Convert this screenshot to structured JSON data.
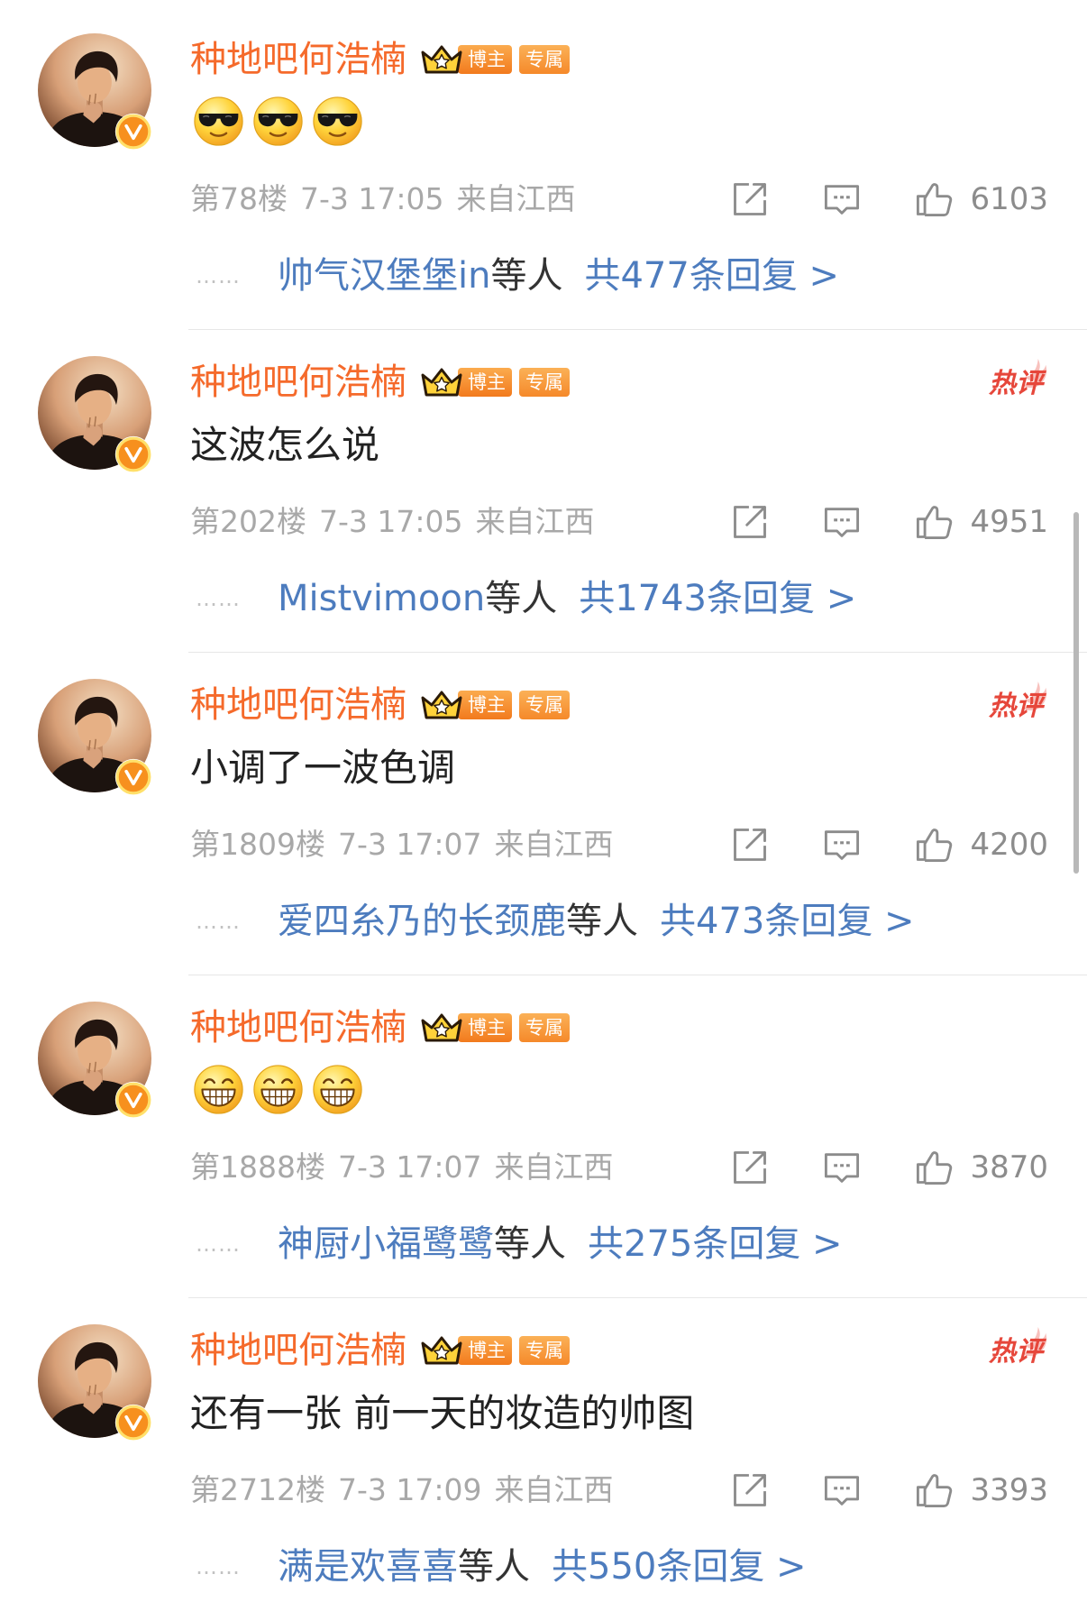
{
  "theme": {
    "name_color": "#f56a2b",
    "link_color": "#4d7cbe",
    "hot_color": "#e6473b",
    "meta_color": "#a8a8a8",
    "icon_color": "#8c8c8c"
  },
  "icons": {
    "avatar": "avatar-photo",
    "verified": "verified-v-icon",
    "crown": "crown-icon",
    "flame": "flame-icon",
    "share": "share-icon",
    "comment": "comment-icon",
    "like": "like-icon"
  },
  "comments": [
    {
      "user": {
        "name": "种地吧何浩楠",
        "badges": [
          "博主",
          "专属"
        ]
      },
      "content": {
        "emojis": [
          "cool-emoji",
          "cool-emoji",
          "cool-emoji"
        ]
      },
      "meta": {
        "floor": "第78楼",
        "time": "7-3 17:05",
        "location": "来自江西"
      },
      "actions": {
        "likes": "6103"
      },
      "replies": {
        "ellipsis": "……",
        "names": "帅气汉堡堡in",
        "suffix": "等人",
        "total": "共477条回复 >"
      }
    },
    {
      "user": {
        "name": "种地吧何浩楠",
        "badges": [
          "博主",
          "专属"
        ]
      },
      "hot_label": "热评",
      "content": {
        "text": "这波怎么说"
      },
      "meta": {
        "floor": "第202楼",
        "time": "7-3 17:05",
        "location": "来自江西"
      },
      "actions": {
        "likes": "4951"
      },
      "replies": {
        "ellipsis": "……",
        "names": "Mistvimoon",
        "suffix": "等人",
        "total": "共1743条回复 >"
      }
    },
    {
      "user": {
        "name": "种地吧何浩楠",
        "badges": [
          "博主",
          "专属"
        ]
      },
      "hot_label": "热评",
      "content": {
        "text": "小调了一波色调"
      },
      "meta": {
        "floor": "第1809楼",
        "time": "7-3 17:07",
        "location": "来自江西"
      },
      "actions": {
        "likes": "4200"
      },
      "replies": {
        "ellipsis": "……",
        "names": "爱四糸乃的长颈鹿",
        "suffix": "等人",
        "total": "共473条回复 >"
      }
    },
    {
      "user": {
        "name": "种地吧何浩楠",
        "badges": [
          "博主",
          "专属"
        ]
      },
      "content": {
        "emojis": [
          "grin-emoji",
          "grin-emoji",
          "grin-emoji"
        ]
      },
      "meta": {
        "floor": "第1888楼",
        "time": "7-3 17:07",
        "location": "来自江西"
      },
      "actions": {
        "likes": "3870"
      },
      "replies": {
        "ellipsis": "……",
        "names": "神厨小福鹭鹭",
        "suffix": "等人",
        "total": "共275条回复 >"
      }
    },
    {
      "user": {
        "name": "种地吧何浩楠",
        "badges": [
          "博主",
          "专属"
        ]
      },
      "hot_label": "热评",
      "content": {
        "text": "还有一张 前一天的妆造的帅图"
      },
      "meta": {
        "floor": "第2712楼",
        "time": "7-3 17:09",
        "location": "来自江西"
      },
      "actions": {
        "likes": "3393"
      },
      "replies": {
        "ellipsis": "……",
        "names": "满是欢喜喜",
        "suffix": "等人",
        "total": "共550条回复 >"
      }
    }
  ]
}
